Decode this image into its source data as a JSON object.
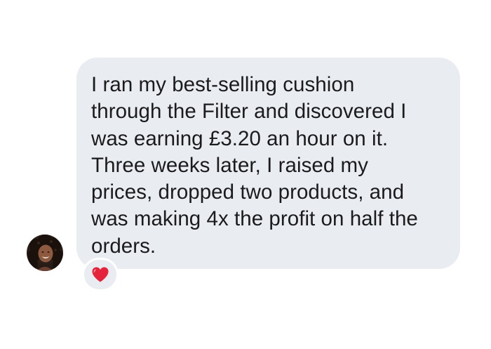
{
  "message": {
    "text": "I ran my best-selling cushion\nthrough the Filter and discovered I\nwas earning £3.20 an hour on it.\nThree weeks later, I raised my\nprices, dropped two products, and\nwas making 4x the profit on half the\norders.",
    "bubble_color": "#e9ecf1",
    "text_color": "#1b1b1d"
  },
  "avatar": {
    "icon": "user-avatar-photo"
  },
  "reaction": {
    "icon": "red-heart-icon",
    "color": "#e5243b"
  }
}
